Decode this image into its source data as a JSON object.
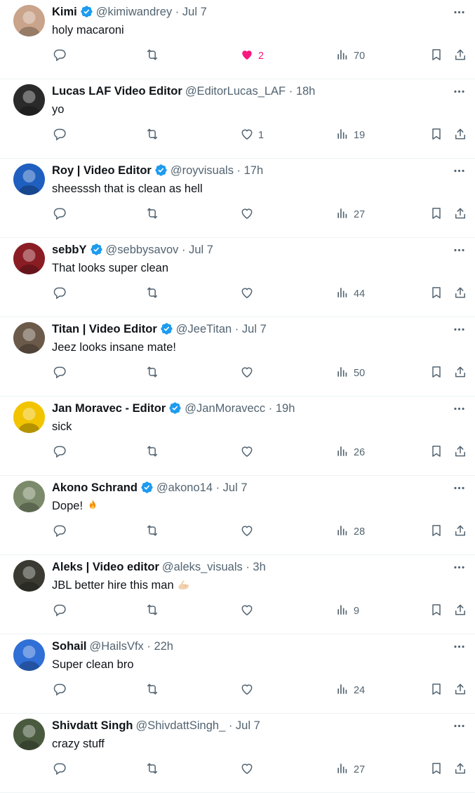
{
  "replies": [
    {
      "name": "Kimi",
      "verified": true,
      "handle": "@kimiwandrey",
      "time": "Jul 7",
      "text": "holy macaroni",
      "emoji": "",
      "likes": "2",
      "liked": true,
      "views": "70",
      "avatar_color": "#c9a48a"
    },
    {
      "name": "Lucas LAF Video Editor",
      "verified": false,
      "handle": "@EditorLucas_LAF",
      "time": "18h",
      "text": "yo",
      "emoji": "",
      "likes": "1",
      "liked": false,
      "views": "19",
      "avatar_color": "#2a2a2a"
    },
    {
      "name": "Roy | Video Editor",
      "verified": true,
      "handle": "@royvisuals",
      "time": "17h",
      "text": "sheesssh that is clean as hell",
      "emoji": "",
      "likes": "",
      "liked": false,
      "views": "27",
      "avatar_color": "#1f5fbf"
    },
    {
      "name": "sebbY",
      "verified": true,
      "handle": "@sebbysavov",
      "time": "Jul 7",
      "text": "That looks super clean",
      "emoji": "",
      "likes": "",
      "liked": false,
      "views": "44",
      "avatar_color": "#8a1c24"
    },
    {
      "name": "Titan | Video Editor",
      "verified": true,
      "handle": "@JeeTitan",
      "time": "Jul 7",
      "text": "Jeez looks insane mate!",
      "emoji": "",
      "likes": "",
      "liked": false,
      "views": "50",
      "avatar_color": "#6b5a4a"
    },
    {
      "name": "Jan Moravec - Editor",
      "verified": true,
      "handle": "@JanMoravecc",
      "time": "19h",
      "text": "sick",
      "emoji": "",
      "likes": "",
      "liked": false,
      "views": "26",
      "avatar_color": "#f2c400"
    },
    {
      "name": "Akono Schrand",
      "verified": true,
      "handle": "@akono14",
      "time": "Jul 7",
      "text": "Dope!",
      "emoji": "fire",
      "likes": "",
      "liked": false,
      "views": "28",
      "avatar_color": "#7b8a6a"
    },
    {
      "name": "Aleks | Video editor",
      "verified": false,
      "handle": "@aleks_visuals",
      "time": "3h",
      "text": "JBL better hire this man",
      "emoji": "flexed-biceps",
      "likes": "",
      "liked": false,
      "views": "9",
      "avatar_color": "#3a3a32"
    },
    {
      "name": "Sohail",
      "verified": false,
      "handle": "@HailsVfx",
      "time": "22h",
      "text": "Super clean bro",
      "emoji": "",
      "likes": "",
      "liked": false,
      "views": "24",
      "avatar_color": "#2f6fd6"
    },
    {
      "name": "Shivdatt Singh",
      "verified": false,
      "handle": "@ShivdattSingh_",
      "time": "Jul 7",
      "text": "crazy stuff",
      "emoji": "",
      "likes": "",
      "liked": false,
      "views": "27",
      "avatar_color": "#4a5a3e"
    }
  ],
  "colors": {
    "accent": "#1d9bf0",
    "like": "#f91880",
    "muted": "#536471",
    "text": "#0f1419"
  },
  "icons": [
    "more-icon",
    "verified-badge-icon",
    "reply-icon",
    "retweet-icon",
    "heart-icon",
    "views-icon",
    "bookmark-icon",
    "share-icon"
  ]
}
